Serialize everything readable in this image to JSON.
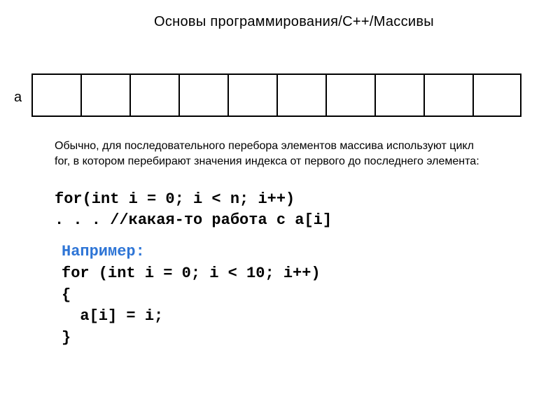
{
  "breadcrumb": "Основы программирования/C++/Массивы",
  "array": {
    "label": "a",
    "cellCount": 10
  },
  "description": "Обычно, для последовательного перебора элементов массива используют цикл for, в котором перебирают значения индекса от первого до последнего элемента:",
  "code": {
    "line1": "for(int i = 0; i < n; i++)",
    "line2": ". . . //какая-то работа с a[i]"
  },
  "example": {
    "label": "Например:",
    "line1": "for (int i = 0; i < 10; i++)",
    "line2": "{",
    "line3": "  a[i] = i;",
    "line4": "}"
  }
}
